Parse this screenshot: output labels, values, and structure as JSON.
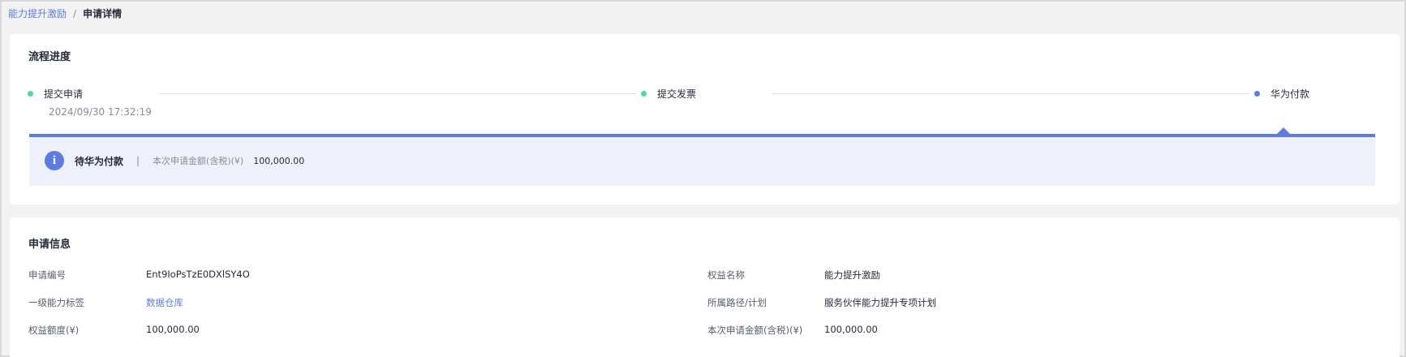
{
  "breadcrumb": {
    "parent": "能力提升激励",
    "separator": "/",
    "current": "申请详情"
  },
  "progress": {
    "title": "流程进度",
    "steps": [
      {
        "label": "提交申请",
        "time": "2024/09/30 17:32:19",
        "color": "#50d4ab"
      },
      {
        "label": "提交发票",
        "color": "#50d4ab"
      },
      {
        "label": "华为付款",
        "color": "#5e7ce0"
      }
    ],
    "status": {
      "icon": "info-icon",
      "text": "待华为付款",
      "divider": "|",
      "amount_label": "本次申请金额(含税)(¥)",
      "amount_value": "100,000.00"
    }
  },
  "info": {
    "title": "申请信息",
    "fields": [
      {
        "label": "申请编号",
        "value": "Ent9IoPsTzE0DXlSY4O"
      },
      {
        "label": "权益名称",
        "value": "能力提升激励"
      },
      {
        "label": "一级能力标签",
        "value": "数据仓库"
      },
      {
        "label": "所属路径/计划",
        "value": "服务伙伴能力提升专项计划"
      },
      {
        "label": "权益额度(¥)",
        "value": "100,000.00"
      },
      {
        "label": "本次申请金额(含税)(¥)",
        "value": "100,000.00"
      }
    ]
  },
  "colors": {
    "accent": "#5e7ce0",
    "success": "#50d4ab",
    "status_bg": "#eef1fc"
  }
}
